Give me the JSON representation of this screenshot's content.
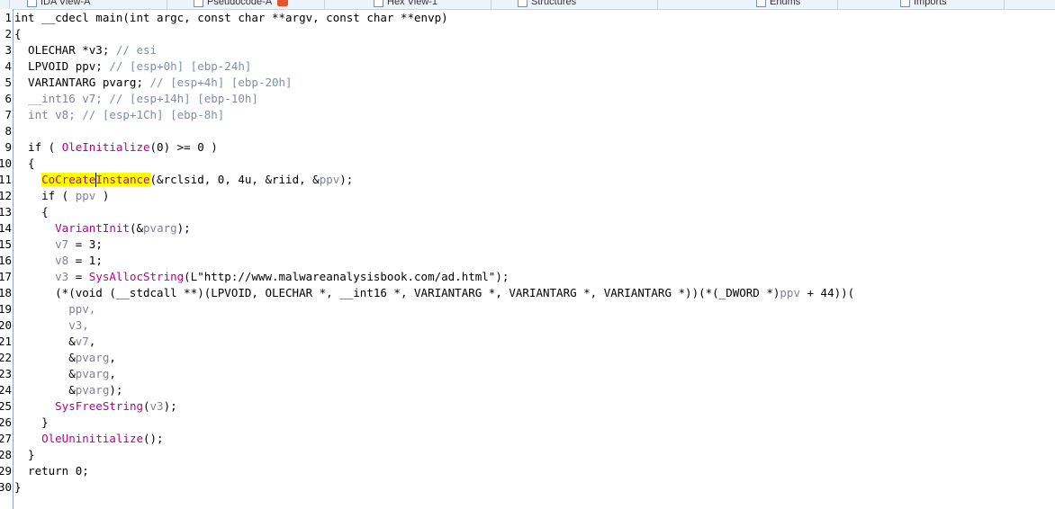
{
  "tabs": [
    {
      "label": "IDA View-A"
    },
    {
      "label": "Pseudocode-A"
    },
    {
      "label": "Hex View-1"
    },
    {
      "label": "Structures"
    },
    {
      "label": "Enums"
    },
    {
      "label": "Imports"
    }
  ],
  "lines": [
    {
      "n": "1",
      "t": [
        {
          "x": "int __cdecl main(int argc, const char **argv, const char **envp)",
          "c": ""
        }
      ]
    },
    {
      "n": "2",
      "t": [
        {
          "x": "{",
          "c": ""
        }
      ]
    },
    {
      "n": "3",
      "t": [
        {
          "x": "  OLECHAR *v3; ",
          "c": ""
        },
        {
          "x": "// esi",
          "c": "c"
        }
      ]
    },
    {
      "n": "4",
      "t": [
        {
          "x": "  LPVOID ppv; ",
          "c": ""
        },
        {
          "x": "// [esp+0h] [ebp-24h]",
          "c": "c"
        }
      ]
    },
    {
      "n": "5",
      "t": [
        {
          "x": "  VARIANTARG pvarg; ",
          "c": ""
        },
        {
          "x": "// [esp+4h] [ebp-20h]",
          "c": "c"
        }
      ]
    },
    {
      "n": "6",
      "t": [
        {
          "x": "  __int16 v7; ",
          "c": "v"
        },
        {
          "x": "// [esp+14h] [ebp-10h]",
          "c": "c"
        }
      ]
    },
    {
      "n": "7",
      "t": [
        {
          "x": "  int v8; ",
          "c": "v"
        },
        {
          "x": "// [esp+1Ch] [ebp-8h]",
          "c": "c"
        }
      ]
    },
    {
      "n": "8",
      "t": [
        {
          "x": "",
          "c": ""
        }
      ]
    },
    {
      "n": "9",
      "t": [
        {
          "x": "  if ( ",
          "c": ""
        },
        {
          "x": "OleInitialize",
          "c": "f"
        },
        {
          "x": "(0) >= 0 )",
          "c": ""
        }
      ]
    },
    {
      "n": "10",
      "t": [
        {
          "x": "  {",
          "c": ""
        }
      ]
    },
    {
      "n": "11",
      "t": [
        {
          "x": "    ",
          "c": ""
        },
        {
          "x": "CoCreateInstance",
          "c": "f hl"
        },
        {
          "x": "(&rclsid, 0, 4u, &riid, &",
          "c": ""
        },
        {
          "x": "ppv",
          "c": "v"
        },
        {
          "x": ");",
          "c": ""
        }
      ]
    },
    {
      "n": "12",
      "t": [
        {
          "x": "    if ( ",
          "c": ""
        },
        {
          "x": "ppv",
          "c": "v"
        },
        {
          "x": " )",
          "c": ""
        }
      ]
    },
    {
      "n": "13",
      "t": [
        {
          "x": "    {",
          "c": ""
        }
      ]
    },
    {
      "n": "14",
      "t": [
        {
          "x": "      ",
          "c": ""
        },
        {
          "x": "VariantInit",
          "c": "f"
        },
        {
          "x": "(&",
          "c": ""
        },
        {
          "x": "pvarg",
          "c": "v"
        },
        {
          "x": ");",
          "c": ""
        }
      ]
    },
    {
      "n": "15",
      "t": [
        {
          "x": "      ",
          "c": ""
        },
        {
          "x": "v7",
          "c": "v"
        },
        {
          "x": " = 3;",
          "c": ""
        }
      ]
    },
    {
      "n": "16",
      "t": [
        {
          "x": "      ",
          "c": ""
        },
        {
          "x": "v8",
          "c": "v"
        },
        {
          "x": " = 1;",
          "c": ""
        }
      ]
    },
    {
      "n": "17",
      "t": [
        {
          "x": "      ",
          "c": ""
        },
        {
          "x": "v3",
          "c": "v"
        },
        {
          "x": " = ",
          "c": ""
        },
        {
          "x": "SysAllocString",
          "c": "f"
        },
        {
          "x": "(L\"http://www.malwareanalysisbook.com/ad.html\");",
          "c": ""
        }
      ]
    },
    {
      "n": "18",
      "t": [
        {
          "x": "      (*(void (__stdcall **)(LPVOID, OLECHAR *, __int16 *, VARIANTARG *, VARIANTARG *, VARIANTARG *))(*(_DWORD *)",
          "c": ""
        },
        {
          "x": "ppv",
          "c": "v"
        },
        {
          "x": " + 44))(",
          "c": ""
        }
      ]
    },
    {
      "n": "19",
      "t": [
        {
          "x": "        ",
          "c": ""
        },
        {
          "x": "ppv,",
          "c": "v"
        }
      ]
    },
    {
      "n": "20",
      "t": [
        {
          "x": "        ",
          "c": ""
        },
        {
          "x": "v3,",
          "c": "v"
        }
      ]
    },
    {
      "n": "21",
      "t": [
        {
          "x": "        &",
          "c": ""
        },
        {
          "x": "v7",
          "c": "v"
        },
        {
          "x": ",",
          "c": ""
        }
      ]
    },
    {
      "n": "22",
      "t": [
        {
          "x": "        &",
          "c": ""
        },
        {
          "x": "pvarg",
          "c": "v"
        },
        {
          "x": ",",
          "c": ""
        }
      ]
    },
    {
      "n": "23",
      "t": [
        {
          "x": "        &",
          "c": ""
        },
        {
          "x": "pvarg",
          "c": "v"
        },
        {
          "x": ",",
          "c": ""
        }
      ]
    },
    {
      "n": "24",
      "t": [
        {
          "x": "        &",
          "c": ""
        },
        {
          "x": "pvarg",
          "c": "v"
        },
        {
          "x": ");",
          "c": ""
        }
      ]
    },
    {
      "n": "25",
      "t": [
        {
          "x": "      ",
          "c": ""
        },
        {
          "x": "SysFreeString",
          "c": "f"
        },
        {
          "x": "(",
          "c": ""
        },
        {
          "x": "v3",
          "c": "v"
        },
        {
          "x": ");",
          "c": ""
        }
      ]
    },
    {
      "n": "26",
      "t": [
        {
          "x": "    }",
          "c": ""
        }
      ]
    },
    {
      "n": "27",
      "t": [
        {
          "x": "    ",
          "c": ""
        },
        {
          "x": "OleUninitialize",
          "c": "f"
        },
        {
          "x": "();",
          "c": ""
        }
      ]
    },
    {
      "n": "28",
      "t": [
        {
          "x": "  }",
          "c": ""
        }
      ]
    },
    {
      "n": "29",
      "t": [
        {
          "x": "  return 0;",
          "c": ""
        }
      ]
    },
    {
      "n": "30",
      "t": [
        {
          "x": "}",
          "c": ""
        }
      ]
    }
  ],
  "colors": {
    "function": "#b8008c",
    "variable": "#8080a0",
    "comment": "#7f8eb0",
    "highlight": "#ffff00"
  }
}
